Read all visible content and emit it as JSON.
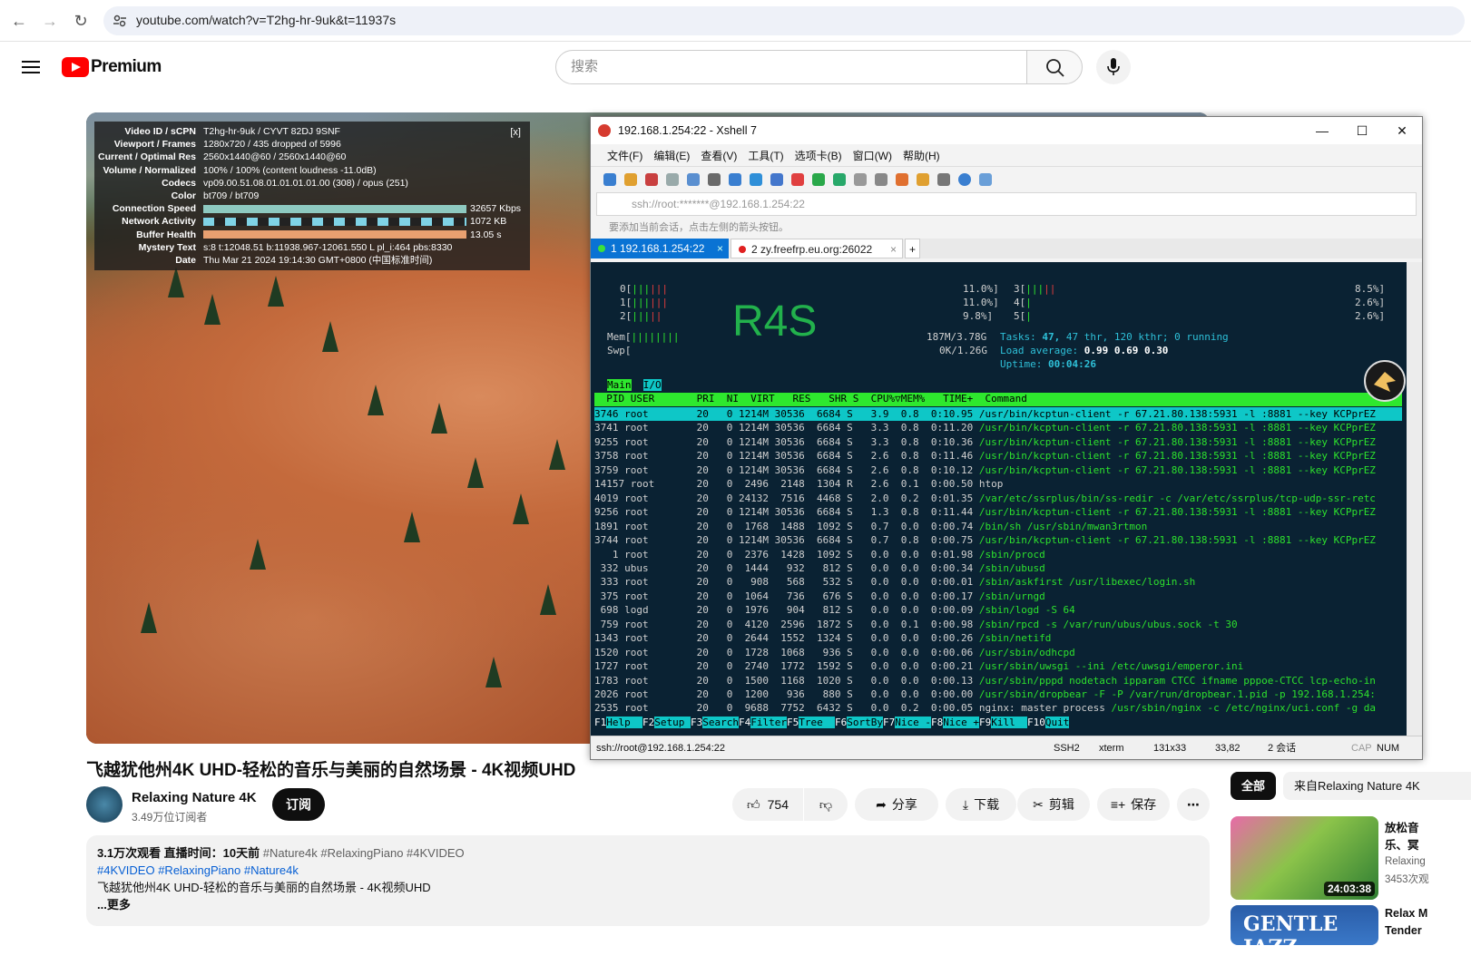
{
  "browser": {
    "url": "youtube.com/watch?v=T2hg-hr-9uk&t=11937s"
  },
  "header": {
    "brand": "Premium",
    "search_placeholder": "搜索"
  },
  "stats": {
    "close": "[x]",
    "rows": [
      {
        "k": "Video ID / sCPN",
        "v": "T2hg-hr-9uk  /  CYVT  82DJ  9SNF"
      },
      {
        "k": "Viewport / Frames",
        "v": "1280x720 / 435 dropped of 5996"
      },
      {
        "k": "Current / Optimal Res",
        "v": "2560x1440@60 / 2560x1440@60"
      },
      {
        "k": "Volume / Normalized",
        "v": "100% / 100% (content loudness -11.0dB)"
      },
      {
        "k": "Codecs",
        "v": "vp09.00.51.08.01.01.01.01.00 (308) / opus (251)"
      },
      {
        "k": "Color",
        "v": "bt709 / bt709"
      },
      {
        "k": "Connection Speed",
        "v": "32657 Kbps"
      },
      {
        "k": "Network Activity",
        "v": "1072 KB"
      },
      {
        "k": "Buffer Health",
        "v": "13.05 s"
      },
      {
        "k": "Mystery Text",
        "v": "s:8 t:12048.51 b:11938.967-12061.550 L pl_i:464 pbs:8330"
      },
      {
        "k": "Date",
        "v": "Thu Mar 21 2024 19:14:30 GMT+0800 (中国标准时间)"
      }
    ]
  },
  "xshell": {
    "title": "192.168.1.254:22 - Xshell 7",
    "menu": [
      "文件(F)",
      "编辑(E)",
      "查看(V)",
      "工具(T)",
      "选项卡(B)",
      "窗口(W)",
      "帮助(H)"
    ],
    "address": "ssh://root:*******@192.168.1.254:22",
    "tip": "要添加当前会话，点击左侧的箭头按钮。",
    "tabs": [
      {
        "label": "1 192.168.1.254:22"
      },
      {
        "label": "2 zy.freefrp.eu.org:26022"
      }
    ],
    "status": {
      "conn": "ssh://root@192.168.1.254:22",
      "proto": "SSH2",
      "term": "xterm",
      "size": "131x33",
      "pos": "33,82",
      "sessions": "2 会话",
      "caps": "CAP",
      "num": "NUM"
    }
  },
  "htop": {
    "hostname": "R4S",
    "cpus": [
      {
        "id": "0",
        "pct": "11.0%"
      },
      {
        "id": "1",
        "pct": "11.0%"
      },
      {
        "id": "2",
        "pct": "9.8%"
      },
      {
        "id": "3",
        "pct": "8.5%"
      },
      {
        "id": "4",
        "pct": "2.6%"
      },
      {
        "id": "5",
        "pct": "2.6%"
      }
    ],
    "mem": "187M/3.78G",
    "swp": "0K/1.26G",
    "tasks_label": "Tasks:",
    "tasks": "47,",
    "thr": "47 thr, 120 kthr; 0 running",
    "load_label": "Load average:",
    "load": "0.99 0.69 0.30",
    "uptime_label": "Uptime:",
    "uptime": "00:04:26",
    "tabs": [
      "Main",
      "I/O"
    ],
    "columns": "  PID USER       PRI  NI  VIRT   RES   SHR S  CPU%▽MEM%   TIME+  Command",
    "rows": [
      "3746 root        20   0 1214M 30536  6684 S   3.9  0.8  0:10.95 /usr/bin/kcptun-client -r 67.21.80.138:5931 -l :8881 --key KCPprEZ",
      "3741 root        20   0 1214M 30536  6684 S   3.3  0.8  0:11.20 /usr/bin/kcptun-client -r 67.21.80.138:5931 -l :8881 --key KCPprEZ",
      "9255 root        20   0 1214M 30536  6684 S   3.3  0.8  0:10.36 /usr/bin/kcptun-client -r 67.21.80.138:5931 -l :8881 --key KCPprEZ",
      "3758 root        20   0 1214M 30536  6684 S   2.6  0.8  0:11.46 /usr/bin/kcptun-client -r 67.21.80.138:5931 -l :8881 --key KCPprEZ",
      "3759 root        20   0 1214M 30536  6684 S   2.6  0.8  0:10.12 /usr/bin/kcptun-client -r 67.21.80.138:5931 -l :8881 --key KCPprEZ",
      "14157 root       20   0  2496  2148  1304 R   2.6  0.1  0:00.50 htop",
      "4019 root        20   0 24132  7516  4468 S   2.0  0.2  0:01.35 /var/etc/ssrplus/bin/ss-redir -c /var/etc/ssrplus/tcp-udp-ssr-retc",
      "9256 root        20   0 1214M 30536  6684 S   1.3  0.8  0:11.44 /usr/bin/kcptun-client -r 67.21.80.138:5931 -l :8881 --key KCPprEZ",
      "1891 root        20   0  1768  1488  1092 S   0.7  0.0  0:00.74 /bin/sh /usr/sbin/mwan3rtmon",
      "3744 root        20   0 1214M 30536  6684 S   0.7  0.8  0:00.75 /usr/bin/kcptun-client -r 67.21.80.138:5931 -l :8881 --key KCPprEZ",
      "   1 root        20   0  2376  1428  1092 S   0.0  0.0  0:01.98 /sbin/procd",
      " 332 ubus        20   0  1444   932   812 S   0.0  0.0  0:00.34 /sbin/ubusd",
      " 333 root        20   0   908   568   532 S   0.0  0.0  0:00.01 /sbin/askfirst /usr/libexec/login.sh",
      " 375 root        20   0  1064   736   676 S   0.0  0.0  0:00.17 /sbin/urngd",
      " 698 logd        20   0  1976   904   812 S   0.0  0.0  0:00.09 /sbin/logd -S 64",
      " 759 root        20   0  4120  2596  1872 S   0.0  0.1  0:00.98 /sbin/rpcd -s /var/run/ubus/ubus.sock -t 30",
      "1343 root        20   0  2644  1552  1324 S   0.0  0.0  0:00.26 /sbin/netifd",
      "1520 root        20   0  1728  1068   936 S   0.0  0.0  0:00.06 /usr/sbin/odhcpd",
      "1727 root        20   0  2740  1772  1592 S   0.0  0.0  0:00.21 /usr/sbin/uwsgi --ini /etc/uwsgi/emperor.ini",
      "1783 root        20   0  1500  1168  1020 S   0.0  0.0  0:00.13 /usr/sbin/pppd nodetach ipparam CTCC ifname pppoe-CTCC lcp-echo-in",
      "2026 root        20   0  1200   936   880 S   0.0  0.0  0:00.00 /usr/sbin/dropbear -F -P /var/run/dropbear.1.pid -p 192.168.1.254:",
      "2535 root        20   0  9688  7752  6432 S   0.0  0.2  0:00.05 nginx: master process /usr/sbin/nginx -c /etc/nginx/uci.conf -g da"
    ],
    "fkeys": [
      {
        "k": "F1",
        "l": "Help  "
      },
      {
        "k": "F2",
        "l": "Setup "
      },
      {
        "k": "F3",
        "l": "Search"
      },
      {
        "k": "F4",
        "l": "Filter"
      },
      {
        "k": "F5",
        "l": "Tree  "
      },
      {
        "k": "F6",
        "l": "SortBy"
      },
      {
        "k": "F7",
        "l": "Nice -"
      },
      {
        "k": "F8",
        "l": "Nice +"
      },
      {
        "k": "F9",
        "l": "Kill  "
      },
      {
        "k": "F10",
        "l": "Quit"
      }
    ]
  },
  "video": {
    "title": "飞越犹他州4K UHD-轻松的音乐与美丽的自然场景 - 4K视频UHD",
    "channel": "Relaxing Nature 4K",
    "subs": "3.49万位订阅者",
    "subscribe": "订阅",
    "likes": "754",
    "share": "分享",
    "download": "下载",
    "clip": "剪辑",
    "save": "保存",
    "more": "⋯",
    "desc_meta": "3.1万次观看  直播时间：10天前",
    "desc_tags1": "#Nature4k #RelaxingPiano #4KVIDEO",
    "desc_tags2": "#4KVIDEO #RelaxingPiano #Nature4k",
    "desc_line": "飞越犹他州4K UHD-轻松的音乐与美丽的自然场景 - 4K视频UHD",
    "desc_more": "...更多"
  },
  "sidebar": {
    "chip_all": "全部",
    "chip_from": "来自Relaxing Nature 4K",
    "items": [
      {
        "title1": "放松音",
        "title2": "乐、冥",
        "channel": "Relaxing",
        "meta": "3453次观",
        "duration": "24:03:38"
      },
      {
        "title1": "Relax M",
        "title2": "Tender",
        "thumb_text": "GENTLE JAZZ"
      }
    ]
  },
  "colors": {
    "brand_red": "#ff0000",
    "tab_blue": "#0a73d4",
    "htop_green": "#2ee82e",
    "htop_cyan": "#0ec7c7"
  }
}
